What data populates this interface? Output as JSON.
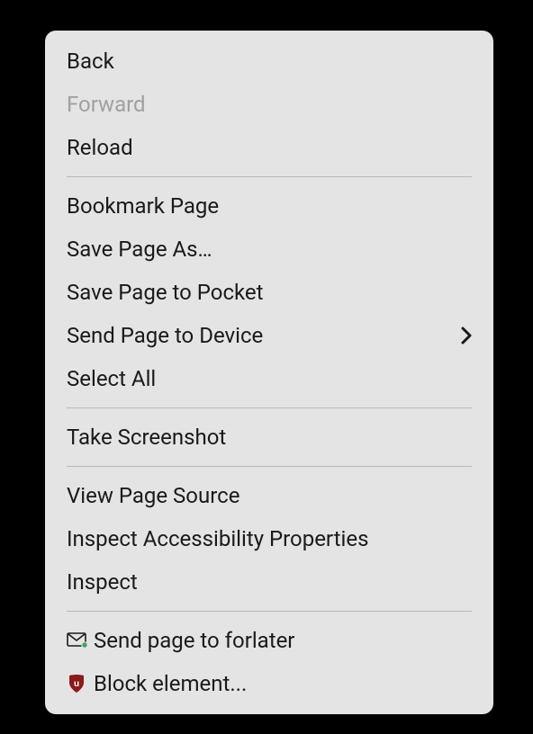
{
  "menu": {
    "items": [
      {
        "label": "Back",
        "name": "back",
        "disabled": false
      },
      {
        "label": "Forward",
        "name": "forward",
        "disabled": true
      },
      {
        "label": "Reload",
        "name": "reload",
        "disabled": false
      }
    ],
    "group2": [
      {
        "label": "Bookmark Page",
        "name": "bookmark-page"
      },
      {
        "label": "Save Page As…",
        "name": "save-page-as"
      },
      {
        "label": "Save Page to Pocket",
        "name": "save-page-to-pocket"
      },
      {
        "label": "Send Page to Device",
        "name": "send-page-to-device",
        "submenu": true
      },
      {
        "label": "Select All",
        "name": "select-all"
      }
    ],
    "group3": [
      {
        "label": "Take Screenshot",
        "name": "take-screenshot"
      }
    ],
    "group4": [
      {
        "label": "View Page Source",
        "name": "view-page-source"
      },
      {
        "label": "Inspect Accessibility Properties",
        "name": "inspect-accessibility"
      },
      {
        "label": "Inspect",
        "name": "inspect"
      }
    ],
    "group5": [
      {
        "label": "Send page to forlater",
        "name": "send-to-forlater",
        "icon": "mail"
      },
      {
        "label": "Block element...",
        "name": "block-element",
        "icon": "ublock"
      }
    ]
  }
}
